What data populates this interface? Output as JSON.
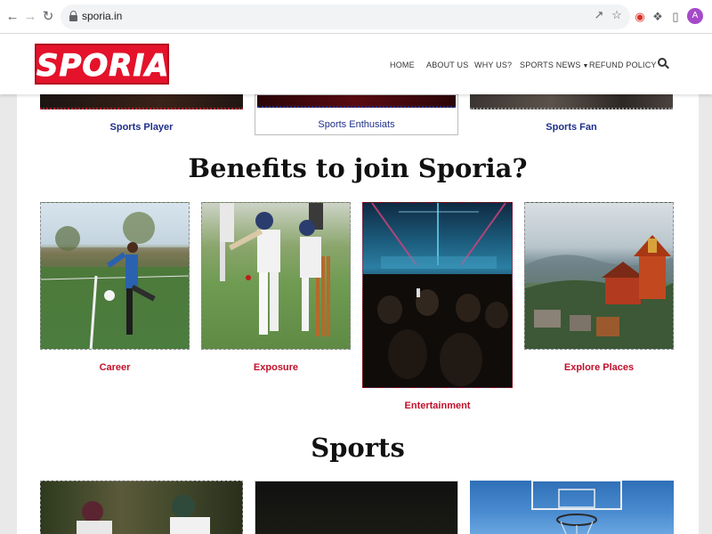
{
  "browser": {
    "url": "sporia.in",
    "back_icon": "arrow-left-icon",
    "forward_icon": "arrow-right-icon",
    "reload_icon": "reload-icon",
    "avatar_initial": "A"
  },
  "header": {
    "logo_text": "SPORIA",
    "brand_color": "#e4122a",
    "nav": [
      {
        "label": "HOME"
      },
      {
        "label": "ABOUT US"
      },
      {
        "label": "WHY US?"
      },
      {
        "label": "SPORTS NEWS"
      },
      {
        "label": "REFUND POLICY"
      }
    ]
  },
  "audience": {
    "items": [
      {
        "label": "Sports Player"
      },
      {
        "label": "Sports Enthusiats"
      },
      {
        "label": "Sports Fan"
      }
    ]
  },
  "benefits": {
    "title": "Benefits to join Sporia?",
    "cards": [
      {
        "label": "Career"
      },
      {
        "label": "Exposure"
      },
      {
        "label": "Entertainment"
      },
      {
        "label": "Explore Places"
      }
    ]
  },
  "sports": {
    "title": "Sports"
  },
  "colors": {
    "caption_blue": "#1f2f8a",
    "caption_red": "#c0102a"
  }
}
